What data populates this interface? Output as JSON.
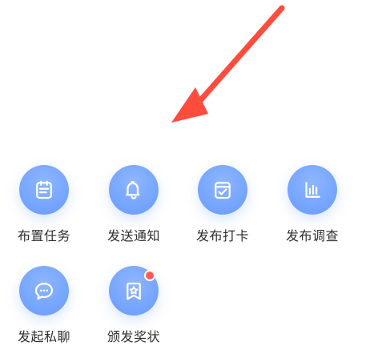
{
  "grid": {
    "items": [
      {
        "label": "布置任务",
        "icon": "calendar-list-icon"
      },
      {
        "label": "发送通知",
        "icon": "bell-icon"
      },
      {
        "label": "发布打卡",
        "icon": "calendar-check-icon"
      },
      {
        "label": "发布调查",
        "icon": "bar-chart-icon"
      },
      {
        "label": "发起私聊",
        "icon": "chat-bubble-icon",
        "badge": false
      },
      {
        "label": "颁发奖状",
        "icon": "award-ribbon-icon",
        "badge": true
      }
    ]
  },
  "colors": {
    "icon_bg": "#78a7ff",
    "badge": "#ff5a5a",
    "arrow": "#ff4d3d",
    "label": "#2f2f2f"
  }
}
